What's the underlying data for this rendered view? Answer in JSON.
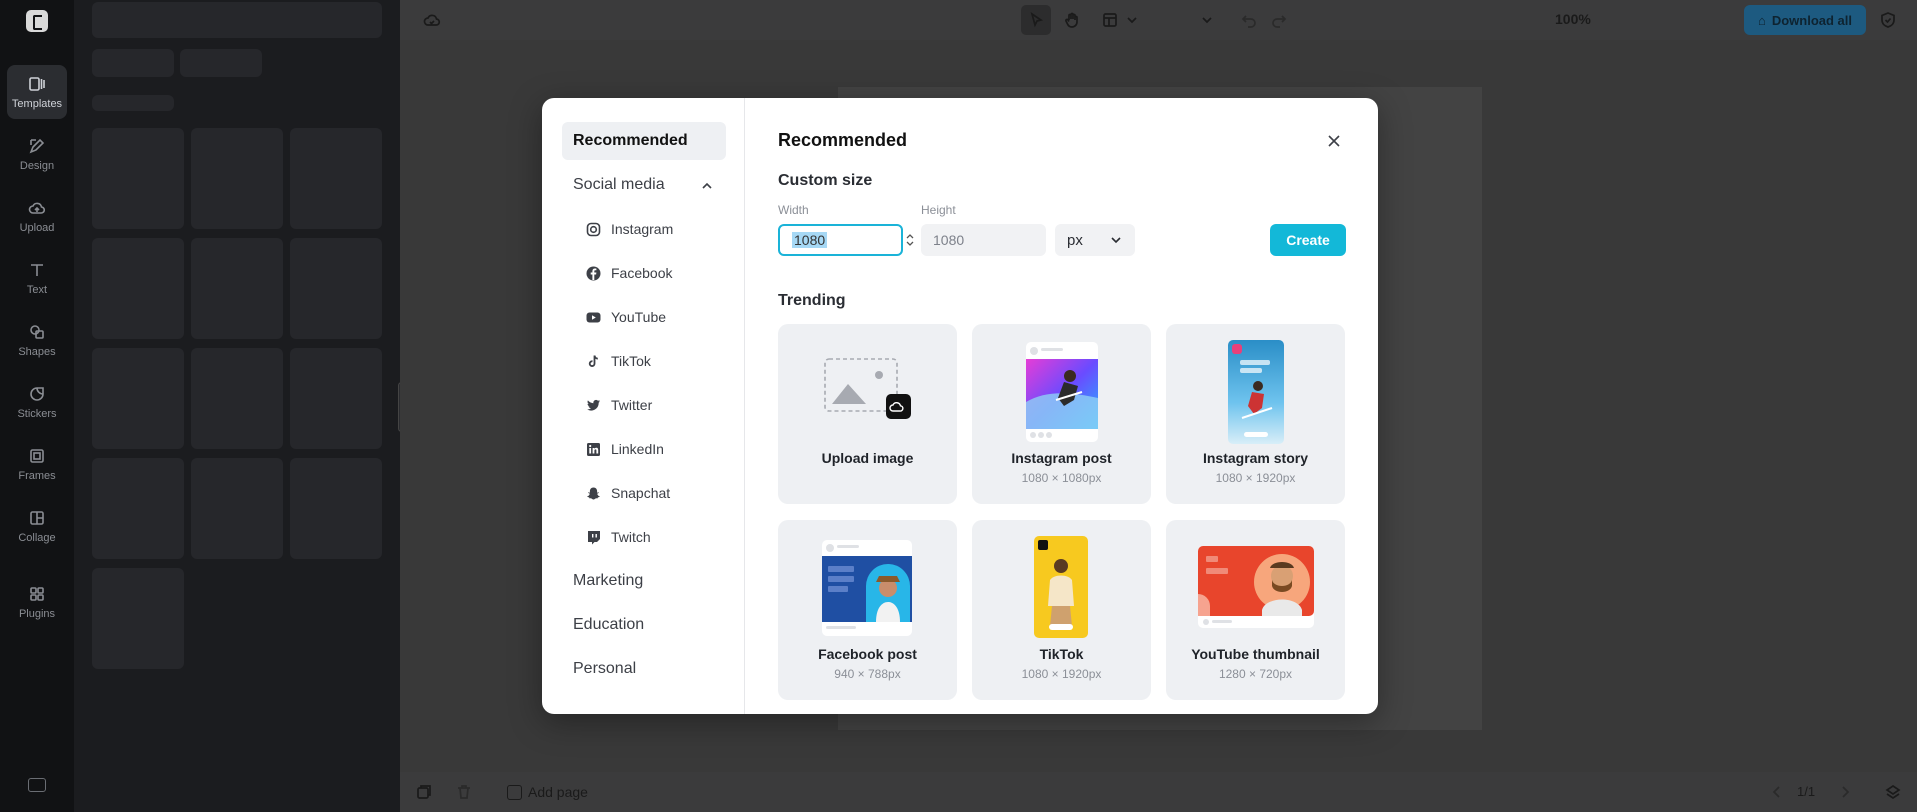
{
  "rail": {
    "items": [
      {
        "label": "Templates",
        "icon": "templates-icon"
      },
      {
        "label": "Design",
        "icon": "design-icon"
      },
      {
        "label": "Upload",
        "icon": "upload-cloud-icon"
      },
      {
        "label": "Text",
        "icon": "text-icon"
      },
      {
        "label": "Shapes",
        "icon": "shapes-icon"
      },
      {
        "label": "Stickers",
        "icon": "stickers-icon"
      },
      {
        "label": "Frames",
        "icon": "frames-icon"
      },
      {
        "label": "Collage",
        "icon": "collage-icon"
      },
      {
        "label": "Plugins",
        "icon": "plugins-icon"
      }
    ]
  },
  "toolbar": {
    "zoom": "100%",
    "download_all": "Download all"
  },
  "bottombar": {
    "add_page": "Add page",
    "page_counter": "1/1"
  },
  "modal": {
    "sidebar": {
      "recommended": "Recommended",
      "social_media": "Social media",
      "social_items": [
        {
          "label": "Instagram",
          "icon": "instagram-icon"
        },
        {
          "label": "Facebook",
          "icon": "facebook-icon"
        },
        {
          "label": "YouTube",
          "icon": "youtube-icon"
        },
        {
          "label": "TikTok",
          "icon": "tiktok-icon"
        },
        {
          "label": "Twitter",
          "icon": "twitter-icon"
        },
        {
          "label": "LinkedIn",
          "icon": "linkedin-icon"
        },
        {
          "label": "Snapchat",
          "icon": "snapchat-icon"
        },
        {
          "label": "Twitch",
          "icon": "twitch-icon"
        }
      ],
      "marketing": "Marketing",
      "education": "Education",
      "personal": "Personal"
    },
    "title": "Recommended",
    "custom_size": {
      "title": "Custom size",
      "width_label": "Width",
      "width_value": "1080",
      "height_label": "Height",
      "height_placeholder": "1080",
      "unit": "px",
      "create": "Create"
    },
    "trending": {
      "title": "Trending",
      "cards": [
        {
          "title": "Upload image",
          "size": ""
        },
        {
          "title": "Instagram post",
          "size": "1080 × 1080px"
        },
        {
          "title": "Instagram story",
          "size": "1080 × 1920px"
        },
        {
          "title": "Facebook post",
          "size": "940 × 788px"
        },
        {
          "title": "TikTok",
          "size": "1080 × 1920px"
        },
        {
          "title": "YouTube thumbnail",
          "size": "1280 × 720px"
        }
      ]
    }
  },
  "colors": {
    "accent": "#13b8d8",
    "download_button": "#1d5a80",
    "modal_bg": "#ffffff",
    "card_bg": "#eef0f3"
  }
}
